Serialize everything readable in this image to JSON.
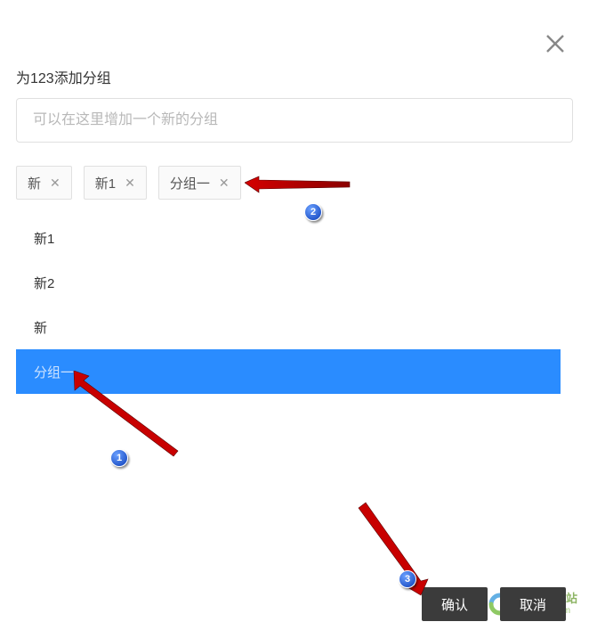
{
  "title": "为123添加分组",
  "input": {
    "placeholder": "可以在这里增加一个新的分组",
    "value": ""
  },
  "tags": [
    {
      "label": "新"
    },
    {
      "label": "新1"
    },
    {
      "label": "分组一"
    }
  ],
  "list": [
    {
      "label": "新1",
      "selected": false
    },
    {
      "label": "新2",
      "selected": false
    },
    {
      "label": "新",
      "selected": false
    },
    {
      "label": "分组一",
      "selected": true
    }
  ],
  "buttons": {
    "confirm": "确认",
    "cancel": "取消"
  },
  "annotations": {
    "badge1": "1",
    "badge2": "2",
    "badge3": "3"
  },
  "watermark": {
    "cn": "极光下载站",
    "en": "www.xz7.com"
  }
}
